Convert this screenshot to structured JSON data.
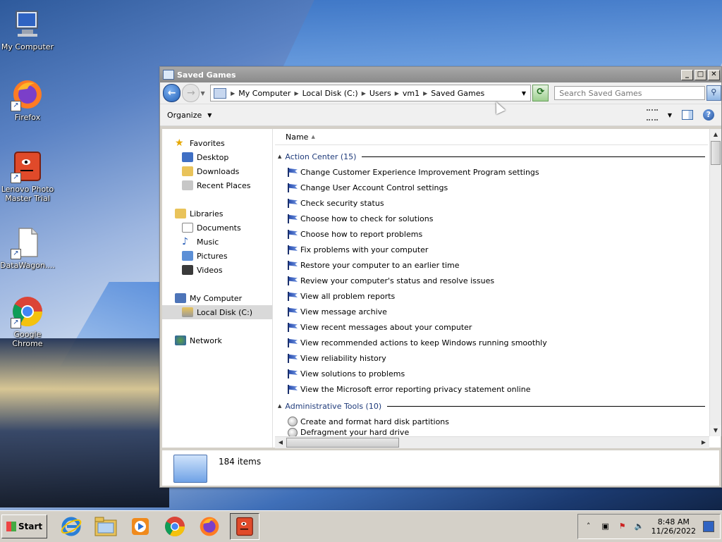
{
  "desktop": {
    "icons": [
      {
        "label": "My Computer"
      },
      {
        "label": "Firefox"
      },
      {
        "label": "Lenovo Photo Master Trial"
      },
      {
        "label": "DataWagon...."
      },
      {
        "label": "Google Chrome"
      }
    ]
  },
  "window": {
    "title": "Saved Games",
    "controls": {
      "minimize": "_",
      "maximize": "□",
      "close": "✕"
    },
    "breadcrumbs": [
      "My Computer",
      "Local Disk (C:)",
      "Users",
      "vm1",
      "Saved Games"
    ],
    "search_placeholder": "Search Saved Games",
    "toolbar": {
      "organize_label": "Organize"
    },
    "nav_pane": {
      "items": [
        {
          "label": "Favorites"
        },
        {
          "label": "Desktop"
        },
        {
          "label": "Downloads"
        },
        {
          "label": "Recent Places"
        },
        {
          "label": "Libraries"
        },
        {
          "label": "Documents"
        },
        {
          "label": "Music"
        },
        {
          "label": "Pictures"
        },
        {
          "label": "Videos"
        },
        {
          "label": "My Computer"
        },
        {
          "label": "Local Disk (C:)"
        },
        {
          "label": "Network"
        }
      ],
      "selected": "Local Disk (C:)"
    },
    "content": {
      "column_header": "Name",
      "groups": [
        {
          "title": "Action Center (15)",
          "items": [
            "Change Customer Experience Improvement Program settings",
            "Change User Account Control settings",
            "Check security status",
            "Choose how to check for solutions",
            "Choose how to report problems",
            "Fix problems with your computer",
            "Restore your computer to an earlier time",
            "Review your computer's status and resolve issues",
            "View all problem reports",
            "View message archive",
            "View recent messages about your computer",
            "View recommended actions to keep Windows running smoothly",
            "View reliability history",
            "View solutions to problems",
            "View the Microsoft error reporting privacy statement online"
          ]
        },
        {
          "title": "Administrative Tools (10)",
          "items": [
            "Create and format hard disk partitions",
            "Defragment your hard drive"
          ]
        }
      ]
    },
    "status": {
      "item_count": "184 items"
    }
  },
  "taskbar": {
    "start_label": "Start",
    "clock": {
      "time": "8:48 AM",
      "date": "11/26/2022"
    }
  },
  "colors": {
    "accent": "#1f5fb8",
    "taskbar": "#d4d0c8",
    "window_frame": "#d4d0c8",
    "group_text": "#1e3a7a"
  }
}
